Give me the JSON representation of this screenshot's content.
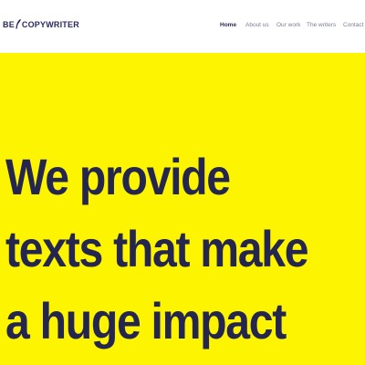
{
  "brand": {
    "logo_prefix": "BE",
    "logo_suffix": "COPYWRITER",
    "accent_color": "#fcf400",
    "text_color": "#252650",
    "logo_mark_icon": "quill-icon"
  },
  "nav": {
    "items": [
      {
        "label": "Home",
        "active": true
      },
      {
        "label": "About us",
        "active": false
      },
      {
        "label": "Our work",
        "active": false
      },
      {
        "label": "The writers",
        "active": false
      },
      {
        "label": "Contact",
        "active": false
      }
    ]
  },
  "hero": {
    "lines": [
      "We provide",
      "texts that make",
      "a huge impact"
    ]
  }
}
